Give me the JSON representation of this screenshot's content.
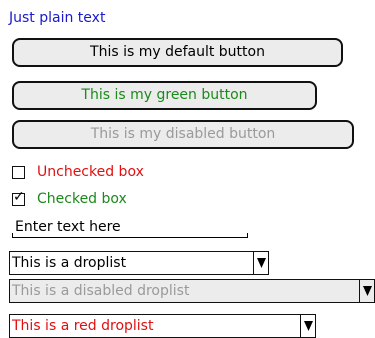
{
  "plain_text": "Just plain text",
  "buttons": {
    "default_label": "This is my default button",
    "green_label": "This is my green button",
    "disabled_label": "This is my disabled button"
  },
  "checkboxes": {
    "unchecked_label": "Unchecked box",
    "unchecked_state": false,
    "checked_label": "Checked box",
    "checked_state": true
  },
  "text_input": {
    "value": "Enter text here"
  },
  "droplists": {
    "default_value": "This is a droplist",
    "disabled_value": "This is a disabled droplist",
    "red_value": "This is a red droplist"
  },
  "colors": {
    "plain_text": "#1a1acc",
    "green": "#1a8a1a",
    "red": "#e01010",
    "disabled": "#9a9a9a",
    "default_text": "#000000"
  }
}
